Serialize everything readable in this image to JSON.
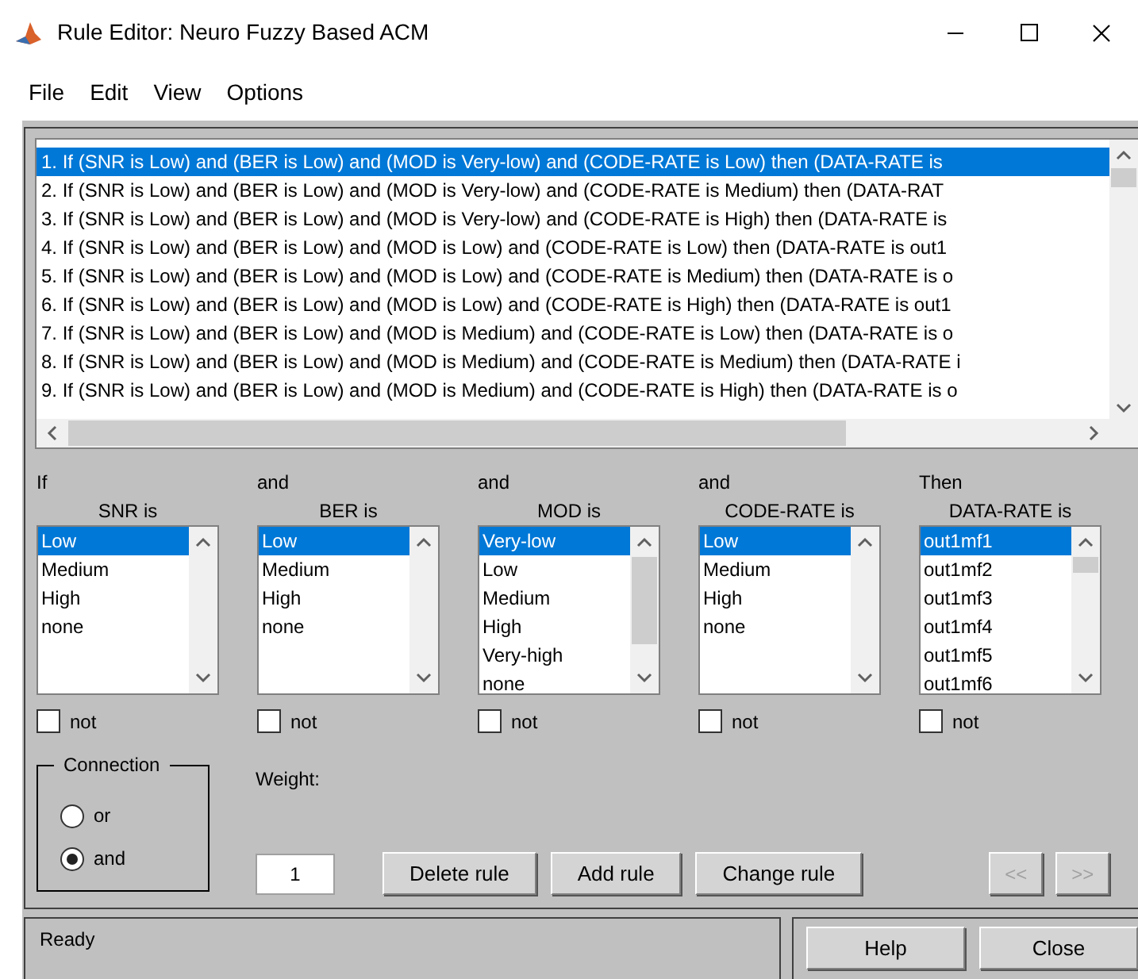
{
  "window": {
    "title": "Rule Editor: Neuro Fuzzy Based ACM"
  },
  "menu": [
    {
      "label": "File"
    },
    {
      "label": "Edit"
    },
    {
      "label": "View"
    },
    {
      "label": "Options"
    }
  ],
  "rules": [
    {
      "text": "1. If (SNR is Low) and (BER is Low) and (MOD is Very-low) and (CODE-RATE is Low) then (DATA-RATE is",
      "selected": true
    },
    {
      "text": "2. If (SNR is Low) and (BER is Low) and (MOD is Very-low) and (CODE-RATE is Medium) then (DATA-RAT",
      "selected": false
    },
    {
      "text": "3. If (SNR is Low) and (BER is Low) and (MOD is Very-low) and (CODE-RATE is High) then (DATA-RATE is",
      "selected": false
    },
    {
      "text": "4. If (SNR is Low) and (BER is Low) and (MOD is Low) and (CODE-RATE is Low) then (DATA-RATE is out1",
      "selected": false
    },
    {
      "text": "5. If (SNR is Low) and (BER is Low) and (MOD is Low) and (CODE-RATE is Medium) then (DATA-RATE is o",
      "selected": false
    },
    {
      "text": "6. If (SNR is Low) and (BER is Low) and (MOD is Low) and (CODE-RATE is High) then (DATA-RATE is out1",
      "selected": false
    },
    {
      "text": "7. If (SNR is Low) and (BER is Low) and (MOD is Medium) and (CODE-RATE is Low) then (DATA-RATE is o",
      "selected": false
    },
    {
      "text": "8. If (SNR is Low) and (BER is Low) and (MOD is Medium) and (CODE-RATE is Medium) then (DATA-RATE i",
      "selected": false
    },
    {
      "text": "9. If (SNR is Low) and (BER is Low) and (MOD is Medium) and (CODE-RATE is High) then (DATA-RATE is o",
      "selected": false
    }
  ],
  "clauses": [
    {
      "connective": "If",
      "variable": "SNR is",
      "not_label": "not",
      "not_checked": false,
      "options": [
        {
          "label": "Low",
          "selected": true
        },
        {
          "label": "Medium",
          "selected": false
        },
        {
          "label": "High",
          "selected": false
        },
        {
          "label": "none",
          "selected": false
        }
      ]
    },
    {
      "connective": "and",
      "variable": "BER is",
      "not_label": "not",
      "not_checked": false,
      "options": [
        {
          "label": "Low",
          "selected": true
        },
        {
          "label": "Medium",
          "selected": false
        },
        {
          "label": "High",
          "selected": false
        },
        {
          "label": "none",
          "selected": false
        }
      ]
    },
    {
      "connective": "and",
      "variable": "MOD is",
      "not_label": "not",
      "not_checked": false,
      "options": [
        {
          "label": "Very-low",
          "selected": true
        },
        {
          "label": "Low",
          "selected": false
        },
        {
          "label": "Medium",
          "selected": false
        },
        {
          "label": "High",
          "selected": false
        },
        {
          "label": "Very-high",
          "selected": false
        },
        {
          "label": "none",
          "selected": false
        }
      ]
    },
    {
      "connective": "and",
      "variable": "CODE-RATE is",
      "not_label": "not",
      "not_checked": false,
      "options": [
        {
          "label": "Low",
          "selected": true
        },
        {
          "label": "Medium",
          "selected": false
        },
        {
          "label": "High",
          "selected": false
        },
        {
          "label": "none",
          "selected": false
        }
      ]
    },
    {
      "connective": "Then",
      "variable": "DATA-RATE is",
      "not_label": "not",
      "not_checked": false,
      "options": [
        {
          "label": "out1mf1",
          "selected": true
        },
        {
          "label": "out1mf2",
          "selected": false
        },
        {
          "label": "out1mf3",
          "selected": false
        },
        {
          "label": "out1mf4",
          "selected": false
        },
        {
          "label": "out1mf5",
          "selected": false
        },
        {
          "label": "out1mf6",
          "selected": false
        }
      ]
    }
  ],
  "connection": {
    "title": "Connection",
    "options": [
      {
        "label": "or",
        "selected": false
      },
      {
        "label": "and",
        "selected": true
      }
    ]
  },
  "weight": {
    "label": "Weight:",
    "value": "1"
  },
  "buttons": [
    {
      "label": "Delete rule",
      "disabled": false
    },
    {
      "label": "Add rule",
      "disabled": false
    },
    {
      "label": "Change rule",
      "disabled": false
    }
  ],
  "nav_buttons": [
    {
      "label": "<<",
      "disabled": true
    },
    {
      "label": ">>",
      "disabled": true
    }
  ],
  "status": "Ready",
  "footer_buttons": [
    {
      "label": "Help"
    },
    {
      "label": "Close"
    }
  ]
}
